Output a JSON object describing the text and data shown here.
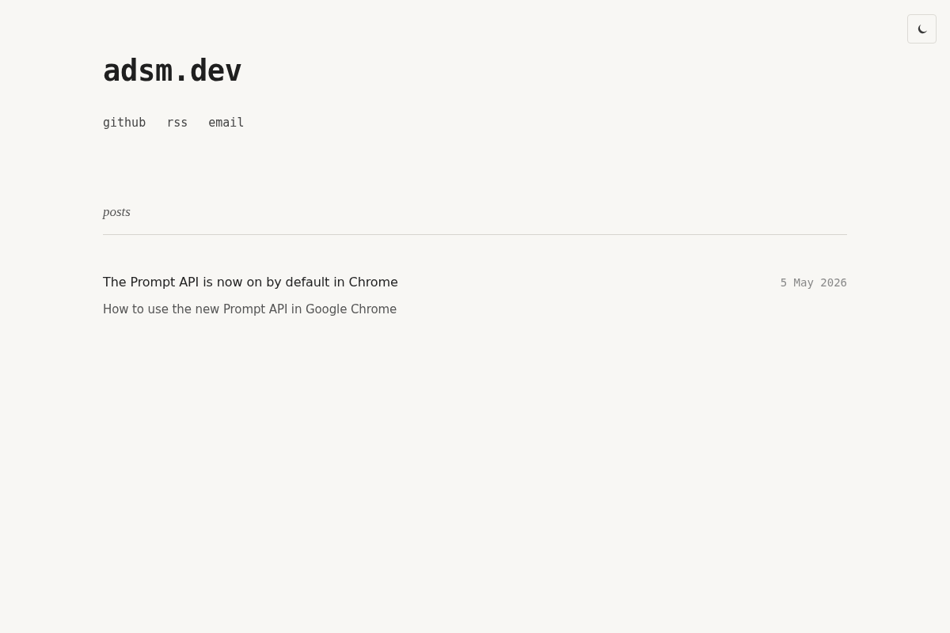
{
  "site": {
    "title": "adsm.dev",
    "links": [
      "github",
      "rss",
      "email"
    ]
  },
  "posts": {
    "heading": "posts",
    "items": [
      {
        "title": "The Prompt API is now on by default in Chrome",
        "date": "5 May 2026",
        "description": "How to use the new Prompt API in Google Chrome"
      }
    ]
  }
}
